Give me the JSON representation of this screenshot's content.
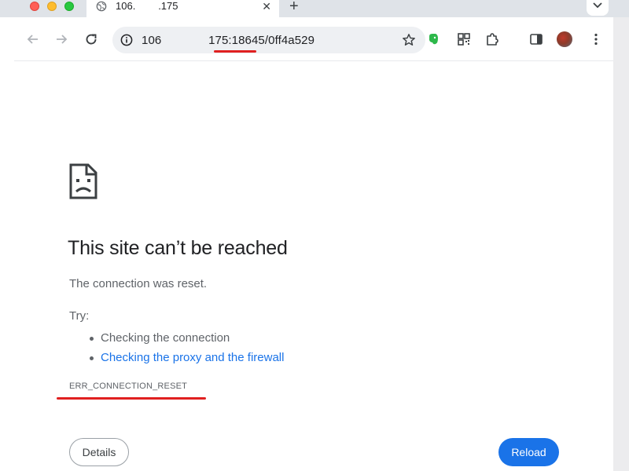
{
  "tab": {
    "title": "106.        .175",
    "close_icon": "close-icon",
    "favicon": "globe-icon"
  },
  "new_tab_label": "+",
  "tab_menu_icon": "chevron-down-icon",
  "toolbar": {
    "back_icon": "arrow-left-icon",
    "forward_icon": "arrow-right-icon",
    "reload_icon": "reload-icon",
    "url": "106              175:18645/0ff4a529",
    "info_icon": "info-icon",
    "bookmark_icon": "star-icon",
    "extensions": [
      "evernote-icon",
      "qr-code-icon",
      "puzzle-icon",
      "sidebar-icon"
    ],
    "menu_icon": "more-vert-icon"
  },
  "error": {
    "heading": "This site can’t be reached",
    "description": "The connection was reset.",
    "try_label": "Try:",
    "suggestions": [
      {
        "text": "Checking the connection",
        "is_link": false
      },
      {
        "text": "Checking the proxy and the firewall",
        "is_link": true
      }
    ],
    "code": "ERR_CONNECTION_RESET",
    "details_button": "Details",
    "reload_button": "Reload"
  },
  "colors": {
    "accent": "#1a73e8",
    "annotation": "#e02020",
    "text": "#202124",
    "secondary_text": "#5f6368"
  }
}
